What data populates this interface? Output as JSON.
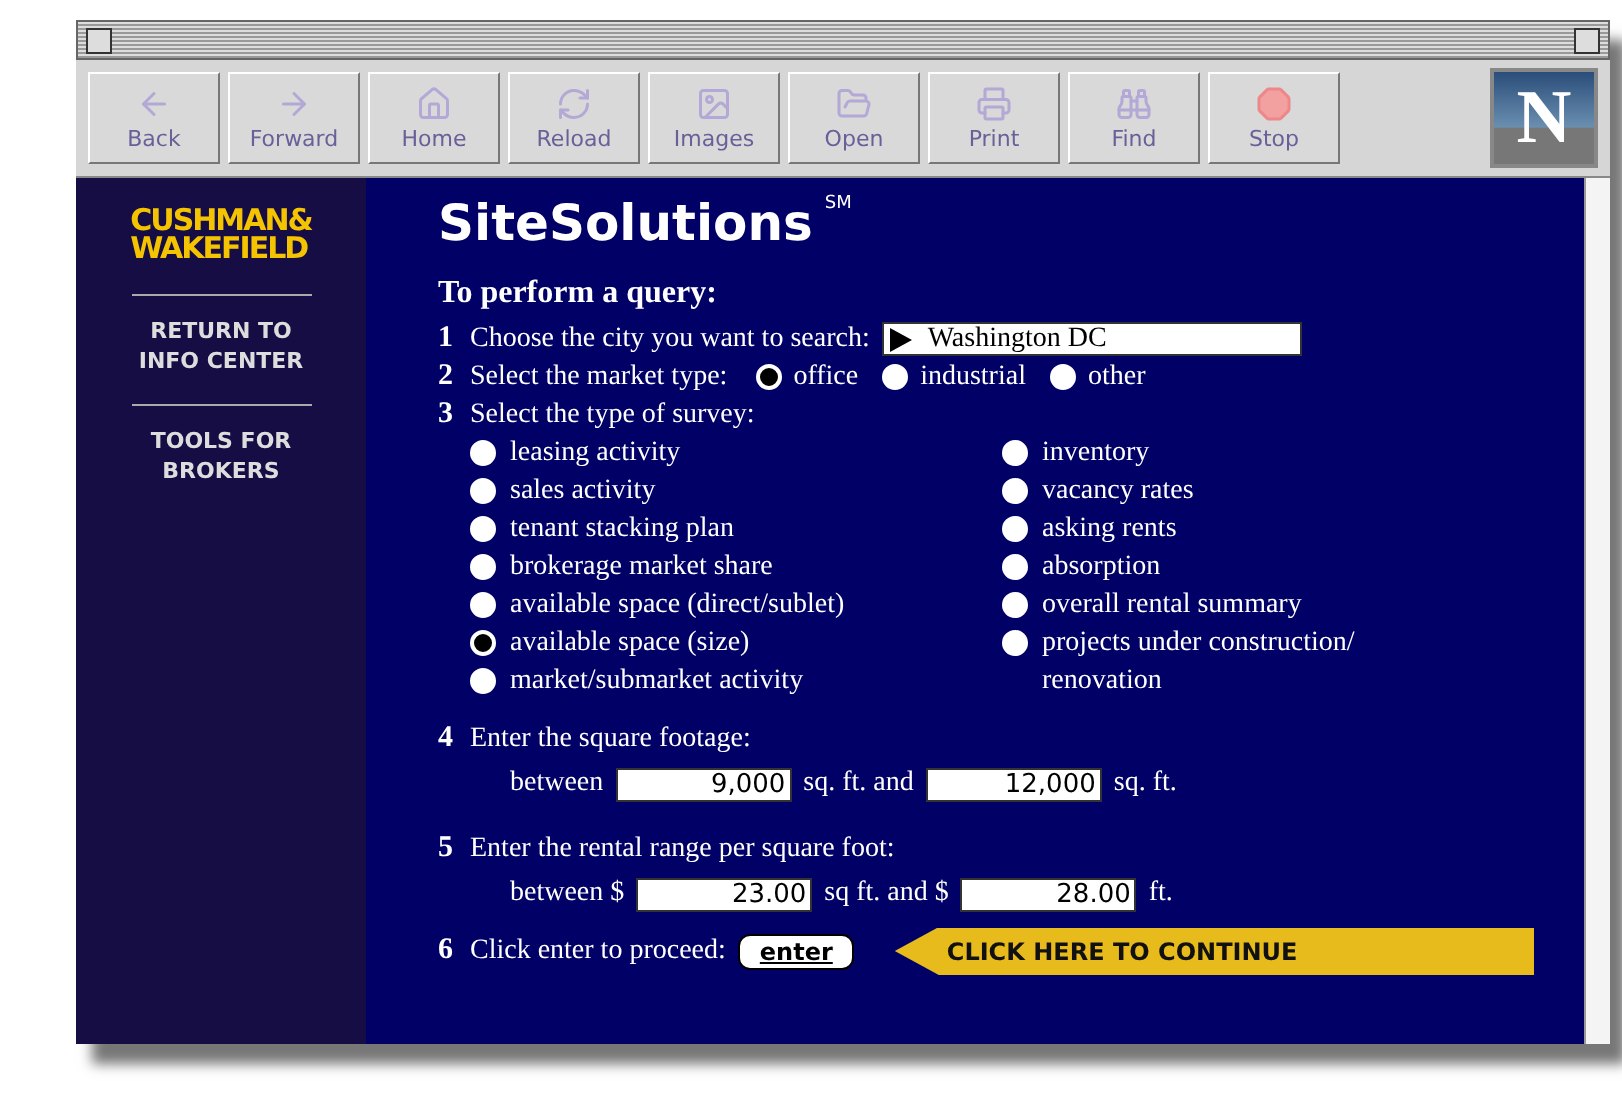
{
  "toolbar": {
    "buttons": [
      {
        "label": "Back",
        "disabled": true
      },
      {
        "label": "Forward",
        "disabled": true
      },
      {
        "label": "Home",
        "disabled": true
      },
      {
        "label": "Reload",
        "disabled": true
      },
      {
        "label": "Images",
        "disabled": true
      },
      {
        "label": "Open",
        "disabled": true
      },
      {
        "label": "Print",
        "disabled": true
      },
      {
        "label": "Find",
        "disabled": true
      },
      {
        "label": "Stop",
        "disabled": true
      }
    ],
    "logo_letter": "N"
  },
  "sidebar": {
    "logo": [
      "CUSHMAN&",
      "WAKEFIELD"
    ],
    "links": [
      "RETURN TO INFO CENTER",
      "TOOLS FOR BROKERS"
    ]
  },
  "page": {
    "title": "SiteSolutions$^{SM}$",
    "heading": "To perform a query:",
    "steps": [
      {
        "number": "1",
        "text": "Choose the city you want to search:",
        "kind": "select",
        "value": "Washington DC"
      },
      {
        "number": "2",
        "text": "Select the market type:",
        "kind": "radios",
        "options": [
          {
            "label": "office",
            "selected": true
          },
          {
            "label": "industrial",
            "selected": false
          },
          {
            "label": "other",
            "selected": false
          }
        ]
      },
      {
        "number": "3",
        "text": "Select the type of survey:",
        "kind": "survey",
        "columns": [
          [
            {
              "label": "leasing activity",
              "selected": false
            },
            {
              "label": "sales activity",
              "selected": false
            },
            {
              "label": "tenant stacking plan",
              "selected": false
            },
            {
              "label": "brokerage market share",
              "selected": false
            },
            {
              "label": "available space (direct/sublet)",
              "selected": false
            },
            {
              "label": "available space (size)",
              "selected": true
            },
            {
              "label": "market/submarket activity",
              "selected": false
            }
          ],
          [
            {
              "label": "inventory",
              "selected": false
            },
            {
              "label": "vacancy rates",
              "selected": false
            },
            {
              "label": "asking rents",
              "selected": false
            },
            {
              "label": "absorption",
              "selected": false
            },
            {
              "label": "overall rental summary",
              "selected": false
            },
            {
              "label": "projects under construction/ renovation",
              "selected": false
            }
          ]
        ]
      },
      {
        "number": "4",
        "text": "Enter the square footage:",
        "kind": "range",
        "parts": [
          "between",
          "sq. ft. and",
          "sq. ft."
        ],
        "values": [
          "9,000",
          "12,000"
        ]
      },
      {
        "number": "5",
        "text": "Enter the rental range per square foot:",
        "kind": "range",
        "parts": [
          "between $",
          "sq ft. and $",
          "ft."
        ],
        "values": [
          "23.00",
          "28.00"
        ]
      },
      {
        "number": "6",
        "text": "Click enter to proceed:",
        "kind": "submit",
        "button": "enter",
        "callout": "CLICK HERE TO CONTINUE"
      }
    ]
  }
}
